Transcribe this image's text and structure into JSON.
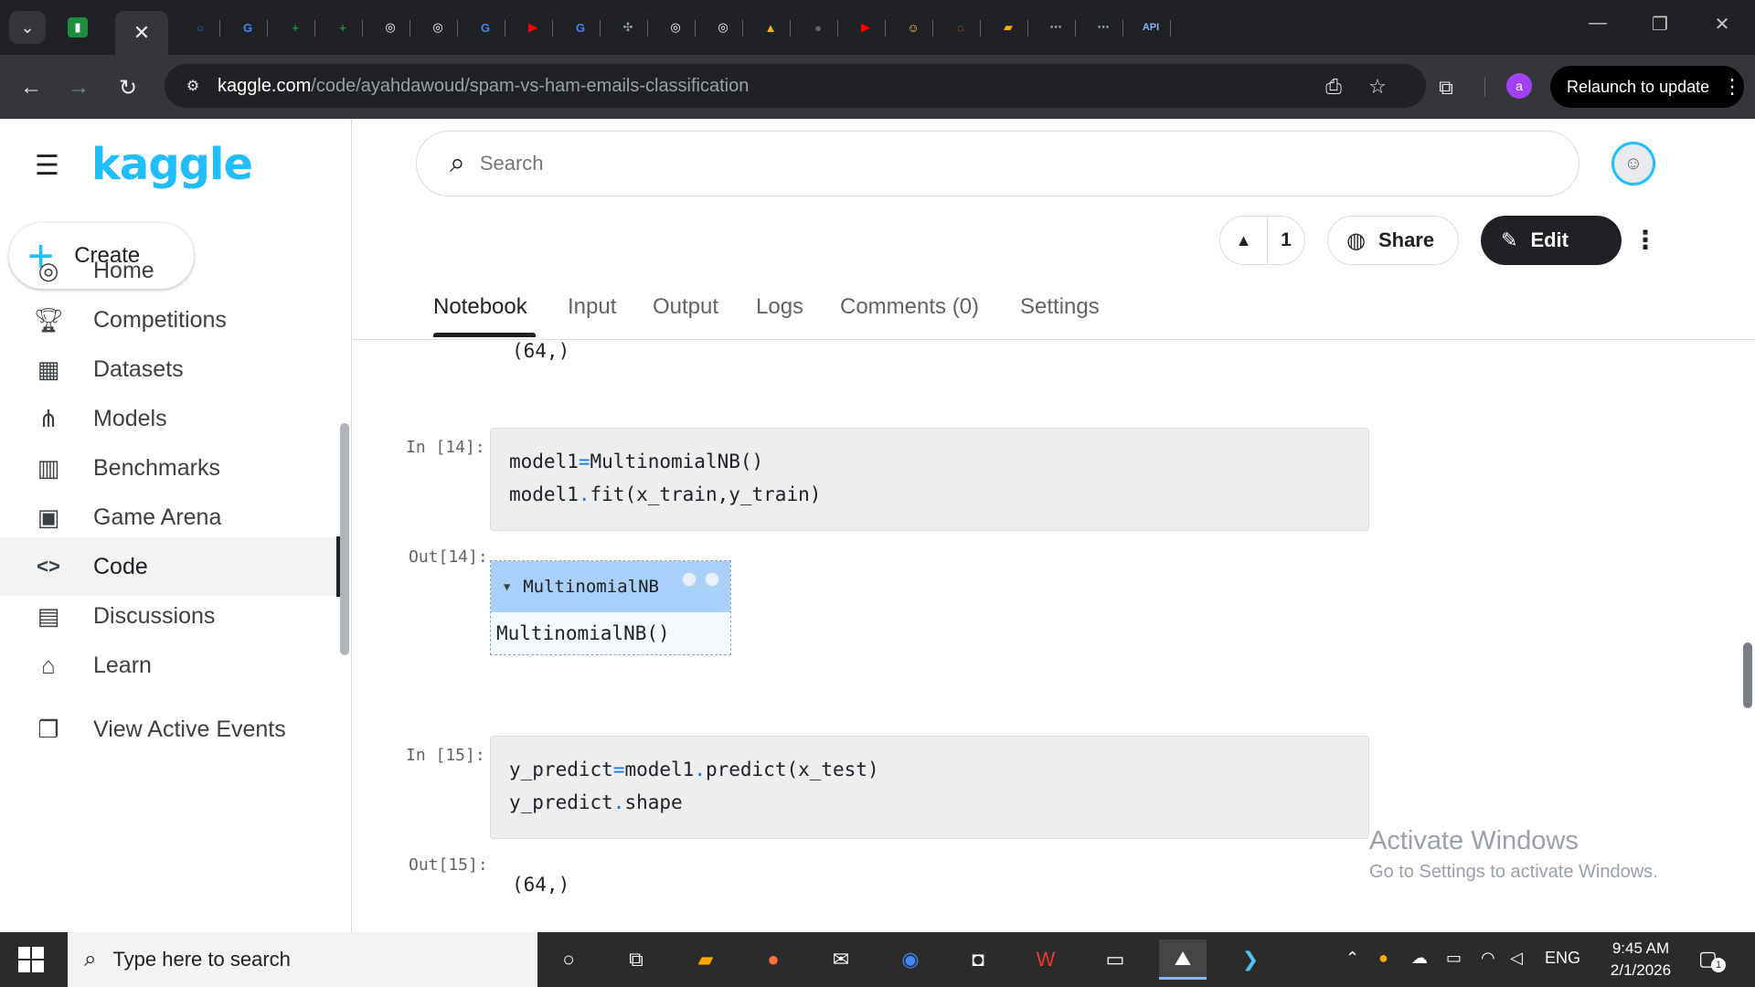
{
  "browser": {
    "active_tab_close": "✕",
    "url_host": "kaggle.com",
    "url_path": "/code/ayahdawoud/spam-vs-ham-emails-classification",
    "profile_initial": "a",
    "relaunch_label": "Relaunch to update",
    "tabs": [
      {
        "icon": "sheets-icon",
        "color": "#1e8e3e",
        "glyph": "▮"
      },
      {
        "icon": "chrome-circle-icon",
        "color": "#1a73e8",
        "glyph": "○"
      },
      {
        "icon": "google-icon",
        "color": "#4285f4",
        "glyph": "G"
      },
      {
        "icon": "sheets-plus-icon",
        "color": "#1e8e3e",
        "glyph": "+"
      },
      {
        "icon": "sheets-plus-icon",
        "color": "#1e8e3e",
        "glyph": "+"
      },
      {
        "icon": "openai-icon",
        "color": "#ffffff",
        "glyph": "◎"
      },
      {
        "icon": "openai-icon",
        "color": "#ffffff",
        "glyph": "◎"
      },
      {
        "icon": "google-icon",
        "color": "#4285f4",
        "glyph": "G"
      },
      {
        "icon": "youtube-icon",
        "color": "#ff0000",
        "glyph": "▶"
      },
      {
        "icon": "google-icon",
        "color": "#4285f4",
        "glyph": "G"
      },
      {
        "icon": "perplexity-icon",
        "color": "#9aa0a6",
        "glyph": "✣"
      },
      {
        "icon": "openai-icon",
        "color": "#ffffff",
        "glyph": "◎"
      },
      {
        "icon": "openai-icon",
        "color": "#ffffff",
        "glyph": "◎"
      },
      {
        "icon": "drive-icon",
        "color": "#fbbc04",
        "glyph": "▲"
      },
      {
        "icon": "github-icon",
        "color": "#5f6368",
        "glyph": "●"
      },
      {
        "icon": "youtube-icon",
        "color": "#ff0000",
        "glyph": "▶"
      },
      {
        "icon": "huggingface-icon",
        "color": "#ffcc4d",
        "glyph": "☺"
      },
      {
        "icon": "jupyter-icon",
        "color": "#f37726",
        "glyph": "◌"
      },
      {
        "icon": "book-icon",
        "color": "#f9ab00",
        "glyph": "▰"
      },
      {
        "icon": "graph-icon",
        "color": "#9aa0a6",
        "glyph": "⋯"
      },
      {
        "icon": "graph-icon",
        "color": "#9aa0a6",
        "glyph": "⋯"
      },
      {
        "icon": "api-icon",
        "color": "#8ab4f8",
        "glyph": "API"
      }
    ]
  },
  "kaggle": {
    "logo": "kaggle",
    "create_label": "Create",
    "search_placeholder": "Search",
    "nav": [
      {
        "label": "Home",
        "icon": "compass-icon",
        "glyph": "◎"
      },
      {
        "label": "Competitions",
        "icon": "trophy-icon",
        "glyph": "🏆︎"
      },
      {
        "label": "Datasets",
        "icon": "table-icon",
        "glyph": "▦"
      },
      {
        "label": "Models",
        "icon": "models-icon",
        "glyph": "⋔"
      },
      {
        "label": "Benchmarks",
        "icon": "bar-chart-icon",
        "glyph": "▥"
      },
      {
        "label": "Game Arena",
        "icon": "robot-icon",
        "glyph": "▣"
      },
      {
        "label": "Code",
        "icon": "code-icon",
        "glyph": "<>"
      },
      {
        "label": "Discussions",
        "icon": "discussion-icon",
        "glyph": "▤"
      },
      {
        "label": "Learn",
        "icon": "school-icon",
        "glyph": "⌂"
      },
      {
        "label": "View Active Events",
        "icon": "events-icon",
        "glyph": "❐"
      }
    ],
    "active_nav": "Code",
    "vote_count": "1",
    "share_label": "Share",
    "edit_label": "Edit",
    "tabs": [
      "Notebook",
      "Input",
      "Output",
      "Logs",
      "Comments (0)",
      "Settings"
    ],
    "active_tab": "Notebook"
  },
  "notebook": {
    "top_output": "(64,)",
    "cell14": {
      "in_prompt": "In [14]:",
      "lines": [
        "model1=MultinomialNB()",
        "model1.fit(x_train,y_train)"
      ],
      "out_prompt": "Out[14]:",
      "estimator_name": "MultinomialNB",
      "estimator_repr": "MultinomialNB()"
    },
    "cell15": {
      "in_prompt": "In [15]:",
      "lines": [
        "y_predict=model1.predict(x_test)",
        "y_predict.shape"
      ],
      "out_prompt": "Out[15]:",
      "output": "(64,)"
    }
  },
  "watermark": {
    "line1": "Activate Windows",
    "line2": "Go to Settings to activate Windows."
  },
  "taskbar": {
    "search_placeholder": "Type here to search",
    "language": "ENG",
    "time": "9:45 AM",
    "date": "2/1/2026",
    "notification_count": "1"
  }
}
